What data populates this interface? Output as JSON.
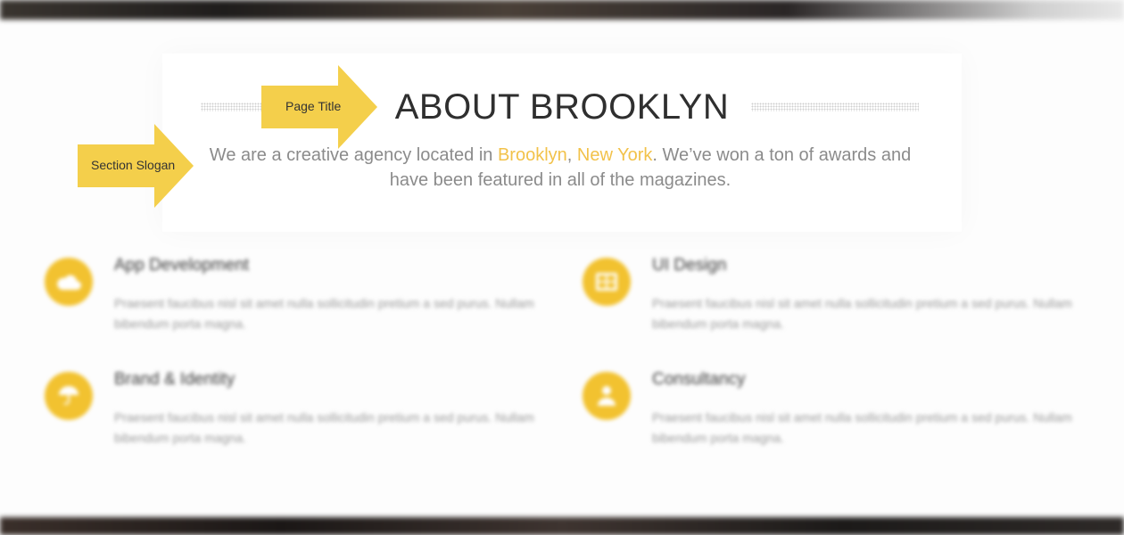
{
  "callouts": {
    "page_title_label": "Page Title",
    "section_slogan_label": "Section Slogan"
  },
  "section": {
    "title": "ABOUT BROOKLYN",
    "slogan_part1": "We are a creative agency located in ",
    "slogan_city": "Brooklyn",
    "slogan_sep": ", ",
    "slogan_state": "New York",
    "slogan_part2": ". We’ve won a ton of awards and have been featured in all of the magazines."
  },
  "features": [
    {
      "title": "App Development",
      "icon": "cloud-icon",
      "text": "Praesent faucibus nisl sit amet nulla sollicitudin pretium a sed purus. Nullam bibendum porta magna."
    },
    {
      "title": "UI Design",
      "icon": "grid-icon",
      "text": "Praesent faucibus nisl sit amet nulla sollicitudin pretium a sed purus. Nullam bibendum porta magna."
    },
    {
      "title": "Brand & Identity",
      "icon": "umbrella-icon",
      "text": "Praesent faucibus nisl sit amet nulla sollicitudin pretium a sed purus. Nullam bibendum porta magna."
    },
    {
      "title": "Consultancy",
      "icon": "user-icon",
      "text": "Praesent faucibus nisl sit amet nulla sollicitudin pretium a sed purus. Nullam bibendum porta magna."
    }
  ],
  "colors": {
    "accent": "#f2c24a",
    "callout": "#f4cf4b",
    "title": "#2f2f2f",
    "slogan": "#8b8b8b"
  }
}
